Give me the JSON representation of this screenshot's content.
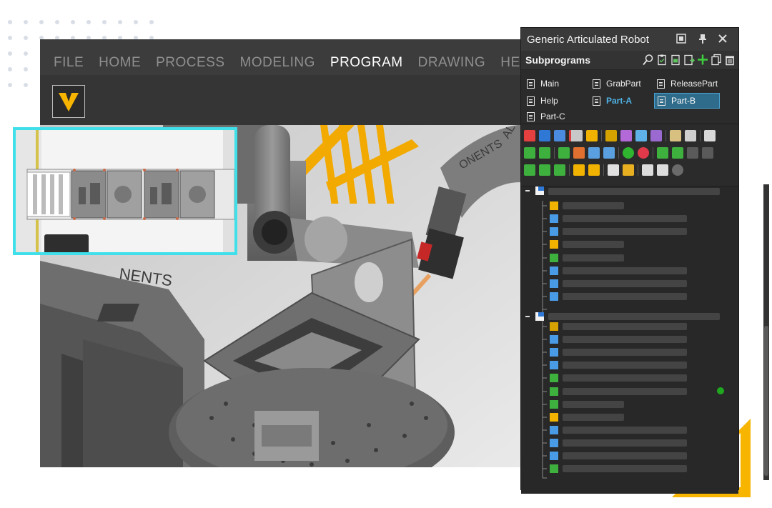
{
  "menu": {
    "items": [
      "FILE",
      "HOME",
      "PROCESS",
      "MODELING",
      "PROGRAM",
      "DRAWING",
      "HELP"
    ],
    "active": "PROGRAM"
  },
  "viewport": {
    "robot_text_upper": "NENTS",
    "robot_text_arm": "ONENTS",
    "robot_text_arm2": "AL"
  },
  "panel": {
    "title": "Generic Articulated Robot",
    "subprograms_label": "Subprograms",
    "programs": [
      {
        "name": "Main"
      },
      {
        "name": "GrabPart"
      },
      {
        "name": "ReleasePart"
      },
      {
        "name": "Help"
      },
      {
        "name": "Part-A",
        "state": "active"
      },
      {
        "name": "Part-B",
        "state": "selected"
      },
      {
        "name": "Part-C"
      }
    ]
  },
  "colors": {
    "accent_cyan": "#3fe0ea",
    "accent_yellow": "#f7b500",
    "selection_blue": "#2f6b8a",
    "active_blue": "#4fb3e6",
    "status_green": "#1fa81f"
  }
}
